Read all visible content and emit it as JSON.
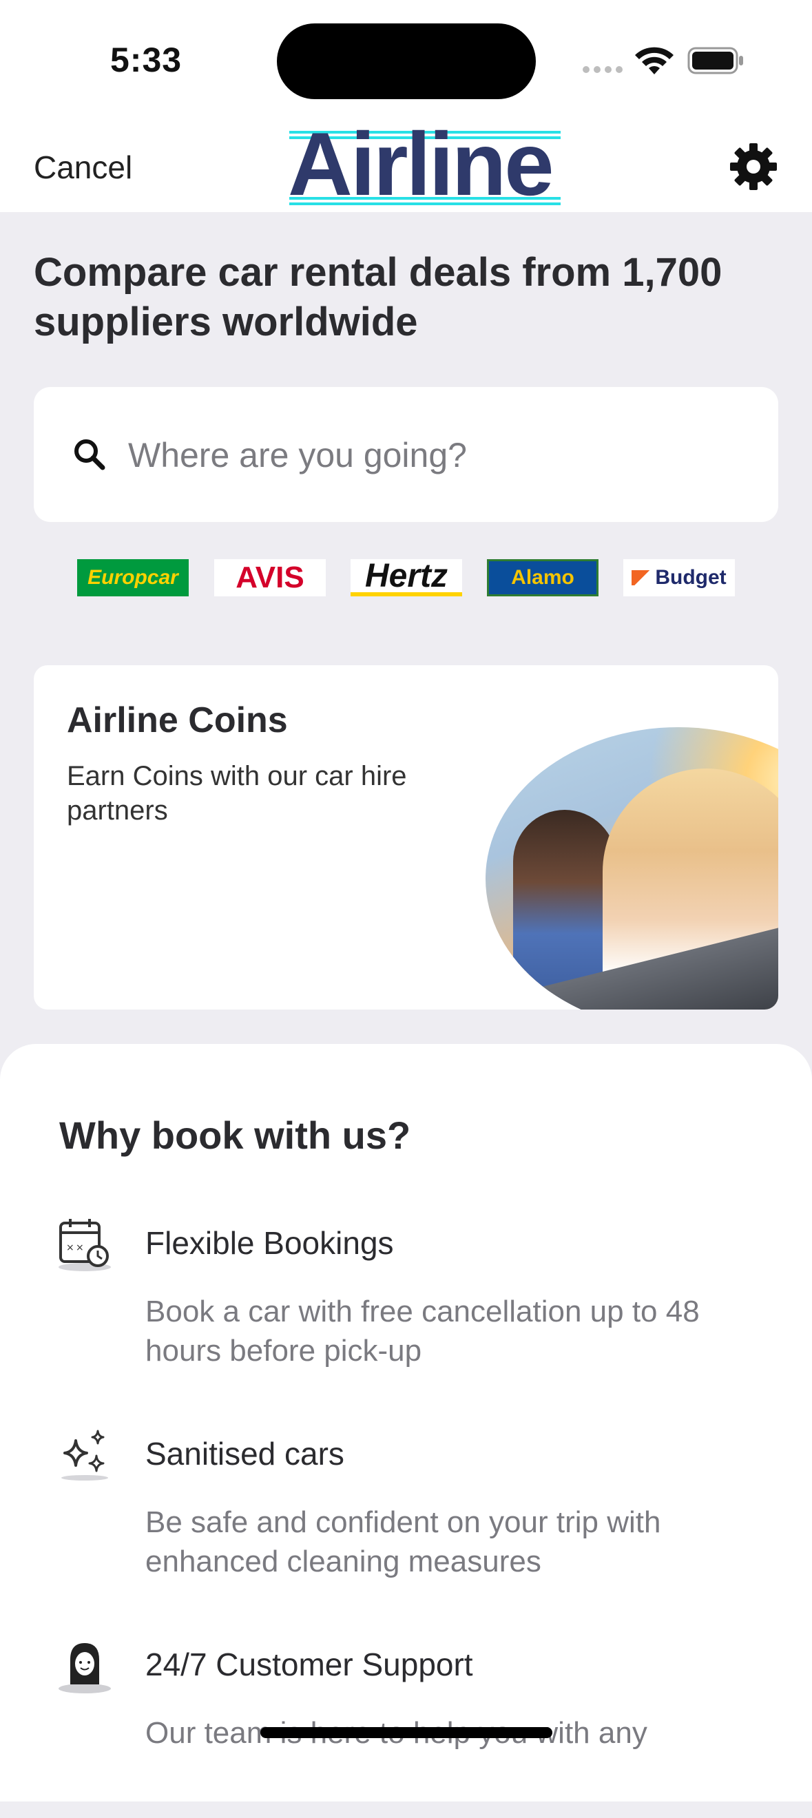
{
  "status_bar": {
    "time": "5:33"
  },
  "nav": {
    "cancel_label": "Cancel",
    "logo_text": "Airline",
    "settings_icon": "gear-icon"
  },
  "headline": "Compare car rental deals from 1,700 suppliers worldwide",
  "search": {
    "placeholder": "Where are you going?",
    "value": "",
    "icon": "search-icon"
  },
  "partners": [
    {
      "name": "Europcar"
    },
    {
      "name": "AVIS"
    },
    {
      "name": "Hertz"
    },
    {
      "name": "Alamo"
    },
    {
      "name": "Budget"
    }
  ],
  "coins_card": {
    "title": "Airline Coins",
    "description": "Earn Coins with our car hire partners"
  },
  "why_book": {
    "title": "Why book with us?",
    "features": [
      {
        "icon": "calendar-icon",
        "title": "Flexible Bookings",
        "description": "Book a car with free cancellation up to 48 hours before pick-up"
      },
      {
        "icon": "sparkles-icon",
        "title": "Sanitised cars",
        "description": "Be safe and confident on your trip with enhanced cleaning measures"
      },
      {
        "icon": "support-agent-icon",
        "title": "24/7 Customer Support",
        "description": "Our team is here to help you with any"
      }
    ]
  },
  "colors": {
    "brand": "#2f3a6b",
    "logo_accent": "#28e0e6",
    "background": "#EEEDF2"
  }
}
